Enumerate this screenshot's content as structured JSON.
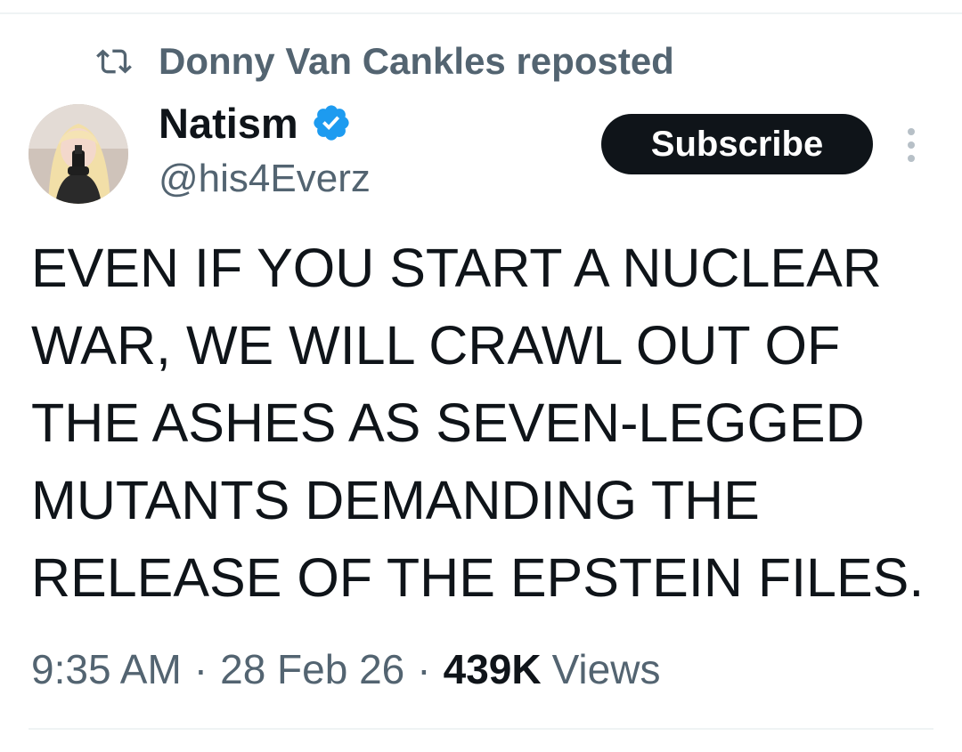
{
  "repost": {
    "text": "Donny Van Cankles reposted",
    "icon": "repost-icon"
  },
  "author": {
    "display_name": "Natism",
    "handle": "@his4Everz",
    "verified_icon": "verified-badge-icon",
    "verified_color": "#1d9bf0"
  },
  "actions": {
    "subscribe_label": "Subscribe",
    "more_icon": "more-vertical-icon"
  },
  "tweet": {
    "lines": [
      "EVEN IF YOU START A NUCLEAR",
      "WAR, WE WILL CRAWL OUT OF",
      "THE ASHES AS SEVEN-LEGGED",
      "MUTANTS DEMANDING THE",
      "RELEASE OF THE EPSTEIN FILES."
    ]
  },
  "meta": {
    "time": "9:35 AM",
    "separator": "·",
    "date": "28 Feb 26",
    "views_count": "439K",
    "views_label": "Views"
  },
  "colors": {
    "text_primary": "#0f1419",
    "text_secondary": "#536471",
    "divider": "#eff3f4",
    "button_bg": "#0f1419"
  }
}
